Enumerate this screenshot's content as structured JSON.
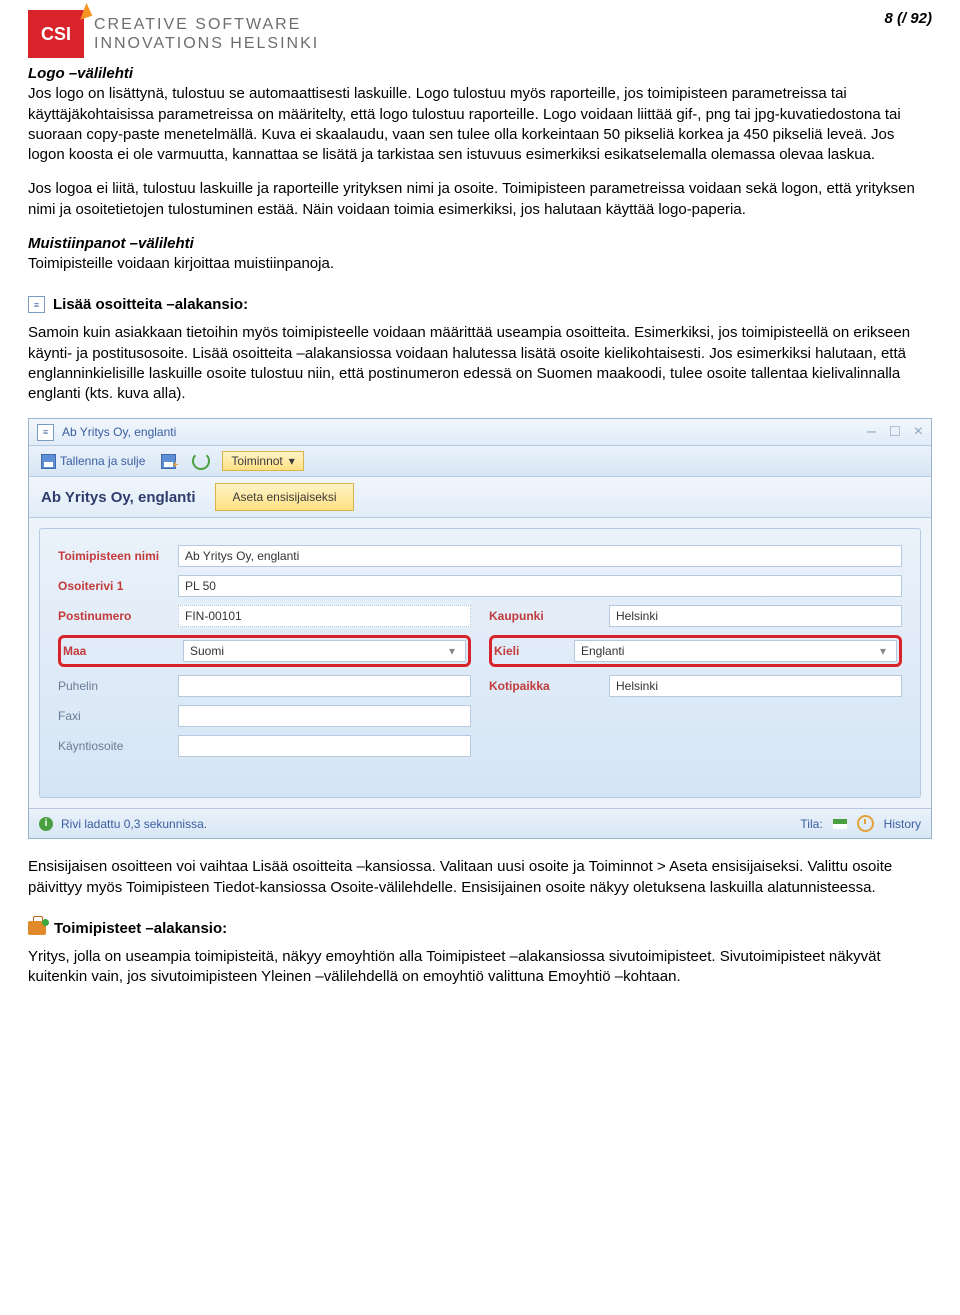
{
  "page_number": "8 (/ 92)",
  "logo": {
    "badge": "CSI",
    "line1": "CREATIVE SOFTWARE",
    "line2": "INNOVATIONS HELSINKI"
  },
  "s1": {
    "title": "Logo –välilehti",
    "p1": "Jos logo on lisättynä, tulostuu se automaattisesti laskuille. Logo tulostuu myös raporteille, jos toimipisteen parametreissa tai käyttäjäkohtaisissa parametreissa on määritelty, että logo tulostuu raporteille. Logo voidaan liittää gif-, png tai jpg-kuvatiedostona tai suoraan copy-paste menetelmällä. Kuva ei skaalaudu, vaan sen tulee olla korkeintaan 50 pikseliä korkea ja 450 pikseliä leveä. Jos logon koosta ei ole varmuutta, kannattaa se lisätä ja tarkistaa sen istuvuus esimerkiksi esikatselemalla olemassa olevaa laskua.",
    "p2": "Jos logoa ei liitä, tulostuu laskuille ja raporteille yrityksen nimi ja osoite. Toimipisteen parametreissa voidaan sekä logon, että yrityksen nimi ja osoitetietojen tulostuminen estää. Näin voidaan toimia esimerkiksi, jos halutaan käyttää logo-paperia."
  },
  "s2": {
    "title": "Muistiinpanot –välilehti",
    "p1": "Toimipisteille voidaan kirjoittaa muistiinpanoja."
  },
  "s3": {
    "title": "Lisää osoitteita –alakansio:",
    "p1": "Samoin kuin asiakkaan tietoihin myös toimipisteelle voidaan määrittää useampia osoitteita. Esimerkiksi, jos toimipisteellä on erikseen käynti- ja postitusosoite. Lisää osoitteita –alakansiossa voidaan halutessa lisätä osoite kielikohtaisesti. Jos esimerkiksi halutaan, että englanninkielisille laskuille osoite tulostuu niin, että postinumeron edessä on Suomen maakoodi, tulee osoite tallentaa kielivalinnalla englanti (kts. kuva alla)."
  },
  "app": {
    "title": "Ab Yritys Oy, englanti",
    "toolbar": {
      "save_close": "Tallenna ja sulje",
      "actions": "Toiminnot"
    },
    "subtitle": "Ab Yritys Oy, englanti",
    "primary_btn": "Aseta ensisijaiseksi",
    "labels": {
      "name": "Toimipisteen nimi",
      "addr1": "Osoiterivi 1",
      "zip": "Postinumero",
      "country": "Maa",
      "phone": "Puhelin",
      "fax": "Faxi",
      "visit": "Käyntiosoite",
      "city": "Kaupunki",
      "lang": "Kieli",
      "domicile": "Kotipaikka"
    },
    "values": {
      "name": "Ab Yritys Oy, englanti",
      "addr1": "PL 50",
      "zip": "FIN-00101",
      "country": "Suomi",
      "city": "Helsinki",
      "lang": "Englanti",
      "domicile": "Helsinki"
    },
    "status": {
      "msg": "Rivi ladattu 0,3 sekunnissa.",
      "tila": "Tila:",
      "history": "History"
    }
  },
  "s4": {
    "p1": "Ensisijaisen osoitteen voi vaihtaa Lisää osoitteita –kansiossa. Valitaan uusi osoite ja Toiminnot > Aseta ensisijaiseksi. Valittu osoite päivittyy myös Toimipisteen Tiedot-kansiossa Osoite-välilehdelle. Ensisijainen osoite näkyy oletuksena laskuilla alatunnisteessa."
  },
  "s5": {
    "title": "Toimipisteet –alakansio:",
    "p1": "Yritys, jolla on useampia toimipisteitä, näkyy emoyhtiön alla Toimipisteet –alakansiossa sivutoimipisteet. Sivutoimipisteet näkyvät kuitenkin vain, jos sivutoimipisteen Yleinen –välilehdellä on emoyhtiö valittuna Emoyhtiö –kohtaan."
  }
}
